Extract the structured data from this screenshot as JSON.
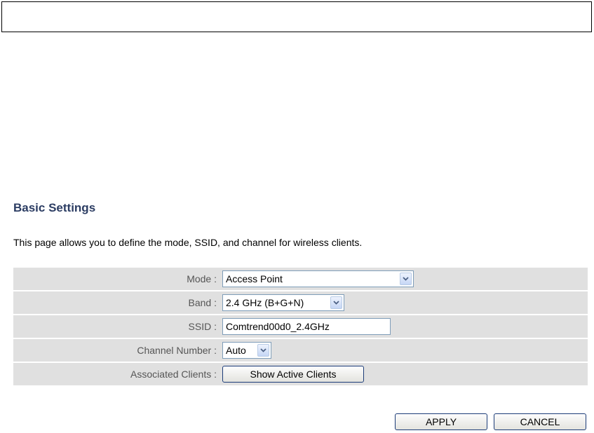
{
  "page": {
    "title": "Basic Settings",
    "description": "This page allows you to define the mode, SSID, and channel for wireless clients."
  },
  "settings": {
    "mode": {
      "label": "Mode :",
      "value": "Access Point"
    },
    "band": {
      "label": "Band :",
      "value": "2.4 GHz (B+G+N)"
    },
    "ssid": {
      "label": "SSID :",
      "value": "Comtrend00d0_2.4GHz"
    },
    "channel": {
      "label": "Channel Number :",
      "value": "Auto"
    },
    "clients": {
      "label": "Associated Clients :",
      "button": "Show Active Clients"
    }
  },
  "actions": {
    "apply": "APPLY",
    "cancel": "CANCEL"
  },
  "icons": {
    "dropdown": "chevron-down-icon"
  },
  "colors": {
    "title": "#2c3d63",
    "row_background": "#e0e0e0",
    "button_border": "#1c3c78"
  }
}
